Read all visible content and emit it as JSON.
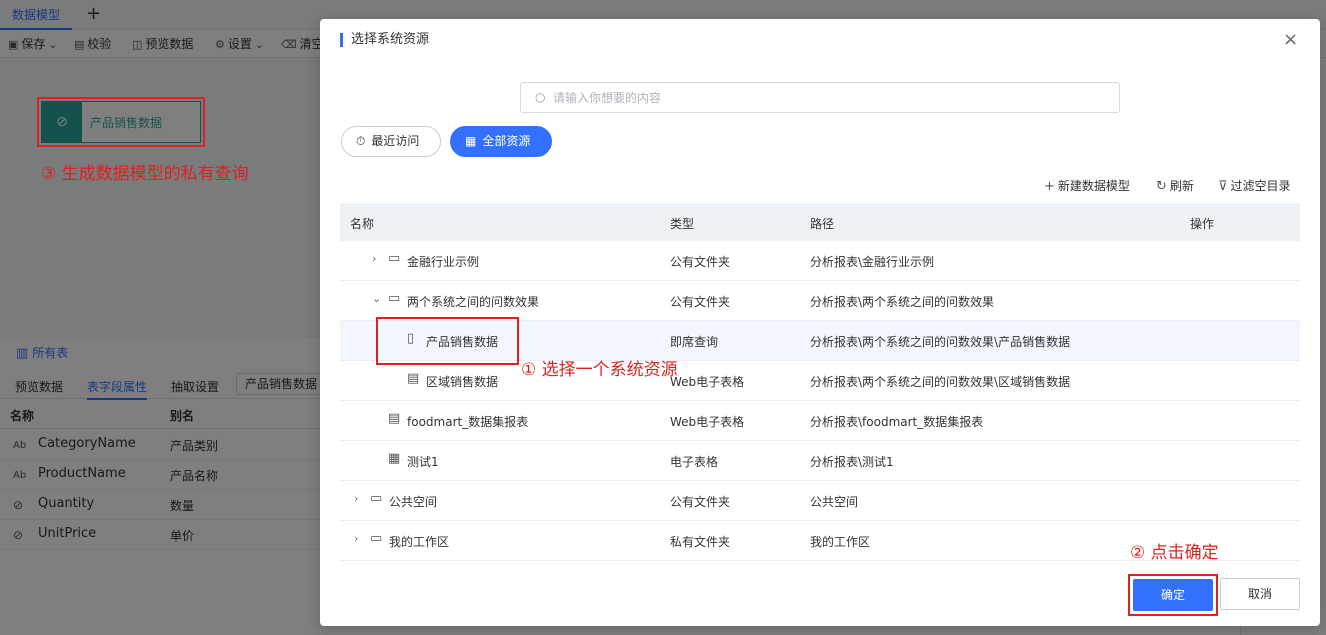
{
  "app": {
    "tab_label": "数据模型",
    "add_tab_symbol": "+",
    "toolbar": {
      "save": "保存",
      "validate": "校验",
      "preview": "预览数据",
      "settings": "设置",
      "clear": "清空"
    },
    "model_node_label": "产品销售数据",
    "all_tables": "所有表",
    "subtabs": [
      "预览数据",
      "表字段属性",
      "抽取设置"
    ],
    "subtab_select_value": "产品销售数据",
    "field_table": {
      "headers": [
        "名称",
        "别名"
      ],
      "rows": [
        {
          "type_icon": "Ab",
          "name": "CategoryName",
          "alias": "产品类别"
        },
        {
          "type_icon": "Ab",
          "name": "ProductName",
          "alias": "产品名称"
        },
        {
          "type_icon": "⊘",
          "name": "Quantity",
          "alias": "数量"
        },
        {
          "type_icon": "⊘",
          "name": "UnitPrice",
          "alias": "单价"
        }
      ]
    }
  },
  "annotations": {
    "step1": "① 选择一个系统资源",
    "step2": "② 点击确定",
    "step3": "③ 生成数据模型的私有查询"
  },
  "dialog": {
    "title": "选择系统资源",
    "close_symbol": "×",
    "search_placeholder": "请输入你想要的内容",
    "pill_recent": "最近访问",
    "pill_all": "全部资源",
    "action_new_model": "新建数据模型",
    "action_refresh": "刷新",
    "action_filter": "过滤空目录",
    "table_headers": {
      "name": "名称",
      "type": "类型",
      "path": "路径",
      "ops": "操作"
    },
    "rows": [
      {
        "name": "金融行业示例",
        "type": "公有文件夹",
        "path": "分析报表\\金融行业示例"
      },
      {
        "name": "两个系统之间的问数效果",
        "type": "公有文件夹",
        "path": "分析报表\\两个系统之间的问数效果"
      },
      {
        "name": "产品销售数据",
        "type": "即席查询",
        "path": "分析报表\\两个系统之间的问数效果\\产品销售数据"
      },
      {
        "name": "区域销售数据",
        "type": "Web电子表格",
        "path": "分析报表\\两个系统之间的问数效果\\区域销售数据"
      },
      {
        "name": "foodmart_数据集报表",
        "type": "Web电子表格",
        "path": "分析报表\\foodmart_数据集报表"
      },
      {
        "name": "测试1",
        "type": "电子表格",
        "path": "分析报表\\测试1"
      },
      {
        "name": "公共空间",
        "type": "公有文件夹",
        "path": "公共空间"
      },
      {
        "name": "我的工作区",
        "type": "私有文件夹",
        "path": "我的工作区"
      }
    ],
    "confirm": "确定",
    "cancel": "取消"
  },
  "colors": {
    "accent": "#3370ff",
    "annotation": "#e02020",
    "node": "#2aa59a"
  }
}
